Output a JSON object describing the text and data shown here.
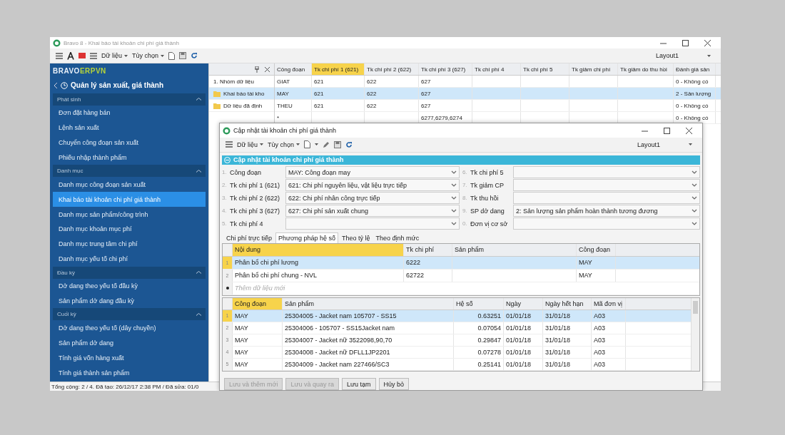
{
  "main_window": {
    "title": "Bravo 8 - Khai báo tài khoản chi phí giá thành",
    "menus": [
      "Dữ liệu",
      "Tùy chọn"
    ],
    "layout": "Layout1"
  },
  "sidebar": {
    "logo": "BRAVO",
    "logo_accent": "ERPVN",
    "module": "Quản lý sản xuất, giá thành",
    "sections": [
      {
        "title": "Phát sinh",
        "expanded": true,
        "items": [
          {
            "label": "Đơn đặt hàng bán",
            "selected": false
          },
          {
            "label": "Lệnh sản xuất",
            "selected": false
          },
          {
            "label": "Chuyển công đoạn sản xuất",
            "selected": false
          },
          {
            "label": "Phiếu nhập thành phẩm",
            "selected": false
          }
        ]
      },
      {
        "title": "Danh mục",
        "expanded": true,
        "items": [
          {
            "label": "Danh mục công đoạn sản xuất",
            "selected": false
          },
          {
            "label": "Khai báo tài khoản chi phí giá thành",
            "selected": true
          },
          {
            "label": "Danh mục sản phẩm/công trình",
            "selected": false
          },
          {
            "label": "Danh mục khoản mục phí",
            "selected": false
          },
          {
            "label": "Danh mục trung tâm chi phí",
            "selected": false
          },
          {
            "label": "Danh mục yếu tố chi phí",
            "selected": false
          }
        ]
      },
      {
        "title": "Đầu kỳ",
        "expanded": true,
        "items": [
          {
            "label": "Dở dang theo yếu tố đầu kỳ",
            "selected": false
          },
          {
            "label": "Sản phẩm dở dang đầu kỳ",
            "selected": false
          }
        ]
      },
      {
        "title": "Cuối kỳ",
        "expanded": true,
        "items": [
          {
            "label": "Dở dang theo yếu tố (dây chuyền)",
            "selected": false
          },
          {
            "label": "Sản phẩm dở dang",
            "selected": false
          },
          {
            "label": "Tính giá vốn hàng xuất",
            "selected": false
          },
          {
            "label": "Tính giá thành sản phẩm",
            "selected": false
          }
        ]
      }
    ]
  },
  "tree": {
    "title": "1. Nhóm dữ liệu",
    "items": [
      {
        "label": "Khai báo tài kho",
        "selected": true
      },
      {
        "label": "Dữ liệu đã định",
        "selected": false
      }
    ]
  },
  "main_grid": {
    "columns": [
      {
        "label": "Công đoạn",
        "selected": false
      },
      {
        "label": "Tk chi phí 1 (621)",
        "selected": true
      },
      {
        "label": "Tk chi phí 2 (622)",
        "selected": false
      },
      {
        "label": "Tk chi phí 3 (627)",
        "selected": false
      },
      {
        "label": "Tk chi phí 4",
        "selected": false
      },
      {
        "label": "Tk chi phí 5",
        "selected": false
      },
      {
        "label": "Tk giảm chi phí",
        "selected": false
      },
      {
        "label": "Tk giảm do thu hồi",
        "selected": false
      },
      {
        "label": "Đánh giá sản",
        "selected": false
      }
    ],
    "rows": [
      {
        "cells": [
          "GIAT",
          "621",
          "622",
          "627",
          null,
          null,
          null,
          null,
          "0 - Không có"
        ],
        "selected": false
      },
      {
        "cells": [
          "MAY",
          "621",
          "622",
          "627",
          null,
          null,
          null,
          null,
          "2 - Sản lượng"
        ],
        "selected": true
      },
      {
        "cells": [
          "THEU",
          "621",
          "622",
          "627",
          null,
          null,
          null,
          null,
          "0 - Không có"
        ],
        "selected": false
      },
      {
        "cells": [
          "*",
          null,
          null,
          "6277,6279,6274",
          null,
          null,
          null,
          null,
          "0 - Không có"
        ],
        "selected": false
      }
    ]
  },
  "status_bar": "Tổng cộng: 2 / 4. Đã tạo: 26/12/17 2:38 PM / Đã sửa: 01/0",
  "dialog": {
    "title": "Cập nhật tài khoản chi phí giá thành",
    "menus": [
      "Dữ liệu",
      "Tùy chọn"
    ],
    "layout": "Layout1",
    "section": {
      "title": "Cập nhật tài khoản chi phí giá thành",
      "expanded": true
    },
    "fields_left": [
      {
        "number": "1.",
        "label": "Công đoạn",
        "value": "MAY: Công đoạn may"
      },
      {
        "number": "2.",
        "label": "Tk chi phí 1 (621)",
        "value": "621: Chi phí nguyên liệu, vật liệu trực tiếp"
      },
      {
        "number": "3.",
        "label": "Tk chi phí 2 (622)",
        "value": "622: Chi phí nhân công trực tiếp"
      },
      {
        "number": "4.",
        "label": "Tk chi phí 3 (627)",
        "value": "627: Chi phí sản xuất chung"
      },
      {
        "number": "5.",
        "label": "Tk chi phí 4"
      }
    ],
    "fields_right": [
      {
        "number": "6.",
        "label": "Tk chi phí 5"
      },
      {
        "number": "7.",
        "label": "Tk giảm CP"
      },
      {
        "number": "8.",
        "label": "Tk thu hồi"
      },
      {
        "number": "9.",
        "label": "SP dở dang",
        "value": "2: Sản lượng sản phẩm hoàn thành tương đương"
      },
      {
        "number": "0.",
        "label": "Đơn vị cơ sở"
      }
    ],
    "tabs": [
      {
        "label": "Chi phí trực tiếp",
        "selected": false
      },
      {
        "label": "Phương pháp hệ số",
        "selected": true
      },
      {
        "label": "Theo tỷ lệ",
        "selected": false
      },
      {
        "label": "Theo định mức",
        "selected": false
      }
    ],
    "allocation_grid": {
      "columns": [
        {
          "label": "Nội dung",
          "selected": true
        },
        {
          "label": "Tk chi phí",
          "selected": false
        },
        {
          "label": "Sản phẩm",
          "selected": false
        },
        {
          "label": "Công đoạn",
          "selected": false
        }
      ],
      "rows": [
        {
          "number": "1",
          "cells": [
            "Phân bổ chi phí lương",
            "6222",
            null,
            "MAY"
          ],
          "selected": true
        },
        {
          "number": "2",
          "cells": [
            "Phân bổ chi phí chung - NVL",
            "62722",
            null,
            "MAY"
          ],
          "selected": false
        }
      ],
      "placeholder": "Thêm dữ liệu mới"
    },
    "coefficient_grid": {
      "columns": [
        {
          "label": "Công đoạn",
          "selected": true
        },
        {
          "label": "Sản phẩm",
          "selected": false
        },
        {
          "label": "Hệ số",
          "selected": false
        },
        {
          "label": "Ngày",
          "selected": false
        },
        {
          "label": "Ngày hết hạn",
          "selected": false
        },
        {
          "label": "Mã đơn vị",
          "selected": false
        }
      ],
      "rows": [
        {
          "number": "1",
          "cells": [
            "MAY",
            "25304005 - Jacket nam 105707 - SS15",
            "0.63251",
            "01/01/18",
            "31/01/18",
            "A03"
          ],
          "selected": true
        },
        {
          "number": "2",
          "cells": [
            "MAY",
            "25304006 - 105707 - SS15Jacket nam",
            "0.07054",
            "01/01/18",
            "31/01/18",
            "A03"
          ],
          "selected": false
        },
        {
          "number": "3",
          "cells": [
            "MAY",
            "25304007 - Jacket nữ 3522098,90,70",
            "0.29847",
            "01/01/18",
            "31/01/18",
            "A03"
          ],
          "selected": false
        },
        {
          "number": "4",
          "cells": [
            "MAY",
            "25304008 - Jacket nữ DFLL1JP2201",
            "0.07278",
            "01/01/18",
            "31/01/18",
            "A03"
          ],
          "selected": false
        },
        {
          "number": "5",
          "cells": [
            "MAY",
            "25304009 - Jacket nam 227466/SC3",
            "0.25141",
            "01/01/18",
            "31/01/18",
            "A03"
          ],
          "selected": false
        }
      ]
    },
    "buttons": [
      {
        "label": "Lưu và thêm mới",
        "disabled": true
      },
      {
        "label": "Lưu và quay ra",
        "disabled": true
      },
      {
        "label": "Lưu tạm",
        "disabled": false
      },
      {
        "label": "Hủy bỏ",
        "disabled": false
      }
    ]
  }
}
